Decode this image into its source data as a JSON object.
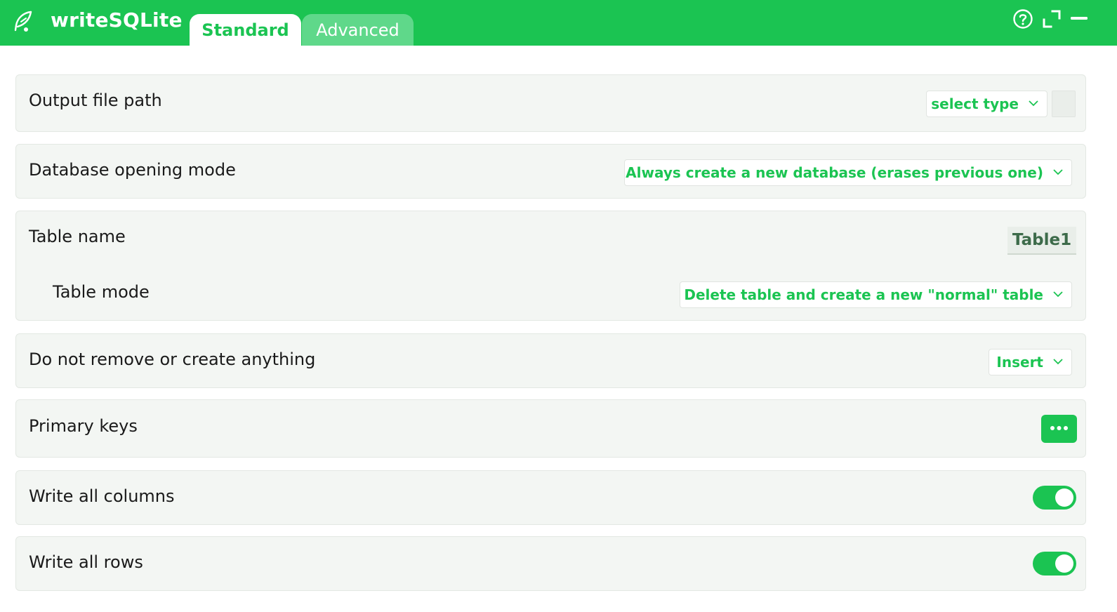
{
  "app": {
    "title": "writeSQLite"
  },
  "tabs": [
    {
      "label": "Standard",
      "active": true
    },
    {
      "label": "Advanced",
      "active": false
    }
  ],
  "icons": {
    "logo": "feather-icon",
    "help": "help-circle-icon",
    "expand": "expand-icon",
    "minimize": "minimize-icon"
  },
  "colors": {
    "accent": "#1bc452",
    "card_background": "#f3f6f3",
    "tab_inactive": "#5fd88a"
  },
  "settings": {
    "output_file_path": {
      "label": "Output file path",
      "select_value": "select type"
    },
    "database_opening_mode": {
      "label": "Database opening mode",
      "select_value": "Always create a new database (erases previous one)"
    },
    "table_name": {
      "label": "Table name",
      "value": "Table1"
    },
    "table_mode": {
      "label": "Table mode",
      "select_value": "Delete table and create a new \"normal\" table"
    },
    "do_not_remove": {
      "label": "Do not remove or create anything",
      "select_value": "Insert"
    },
    "primary_keys": {
      "label": "Primary keys"
    },
    "write_all_columns": {
      "label": "Write all columns",
      "enabled": true
    },
    "write_all_rows": {
      "label": "Write all rows",
      "enabled": true
    }
  }
}
